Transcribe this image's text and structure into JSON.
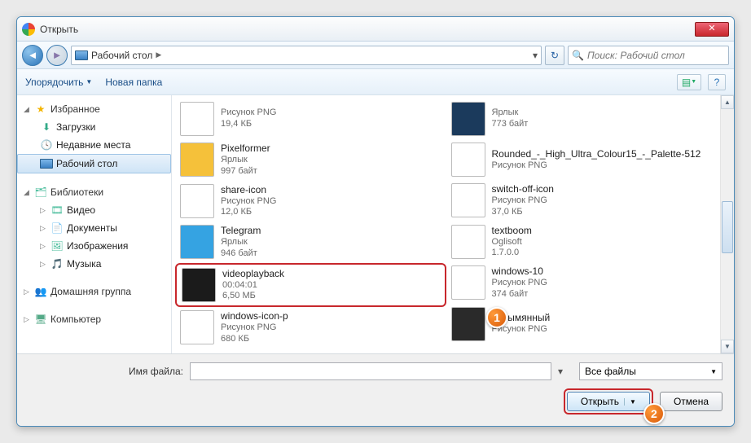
{
  "window": {
    "title": "Открыть"
  },
  "breadcrumb": {
    "location": "Рабочий стол"
  },
  "search": {
    "placeholder": "Поиск: Рабочий стол"
  },
  "toolbar": {
    "organize": "Упорядочить",
    "newfolder": "Новая папка"
  },
  "sidebar": {
    "fav": "Избранное",
    "downloads": "Загрузки",
    "recent": "Недавние места",
    "desktop": "Рабочий стол",
    "libs": "Библиотеки",
    "video": "Видео",
    "docs": "Документы",
    "pics": "Изображения",
    "music": "Музыка",
    "homegroup": "Домашняя группа",
    "computer": "Компьютер"
  },
  "files": {
    "left": [
      {
        "name": "",
        "type": "Рисунок PNG",
        "size": "19,4 КБ",
        "thumb_bg": "#fff"
      },
      {
        "name": "Pixelformer",
        "type": "Ярлык",
        "size": "997 байт",
        "thumb_bg": "#f5c13a"
      },
      {
        "name": "share-icon",
        "type": "Рисунок PNG",
        "size": "12,0 КБ",
        "thumb_bg": "#fff"
      },
      {
        "name": "Telegram",
        "type": "Ярлык",
        "size": "946 байт",
        "thumb_bg": "#35a3e2"
      },
      {
        "name": "videoplayback",
        "type": "00:04:01",
        "size": "6,50 МБ",
        "thumb_bg": "#1b1b1b"
      },
      {
        "name": "windows-icon-p",
        "type": "Рисунок PNG",
        "size": "680 КБ",
        "thumb_bg": "#fff"
      }
    ],
    "right": [
      {
        "name": "",
        "type": "Ярлык",
        "size": "773 байт",
        "thumb_bg": "#1b3a5c"
      },
      {
        "name": "Rounded_-_High_Ultra_Colour15_-_Palette-512",
        "type": "Рисунок PNG",
        "size": "",
        "thumb_bg": "#fff"
      },
      {
        "name": "switch-off-icon",
        "type": "Рисунок PNG",
        "size": "37,0 КБ",
        "thumb_bg": "#fff"
      },
      {
        "name": "textboom",
        "type": "Oglisoft",
        "size": "1.7.0.0",
        "thumb_bg": "#fff"
      },
      {
        "name": "windows-10",
        "type": "Рисунок PNG",
        "size": "374 байт",
        "thumb_bg": "#fff"
      },
      {
        "name": "Безымянный",
        "type": "Рисунок PNG",
        "size": "",
        "thumb_bg": "#2a2a2a"
      }
    ]
  },
  "footer": {
    "filename_label": "Имя файла:",
    "filter": "Все файлы",
    "open": "Открыть",
    "cancel": "Отмена"
  },
  "badges": {
    "b1": "1",
    "b2": "2"
  }
}
